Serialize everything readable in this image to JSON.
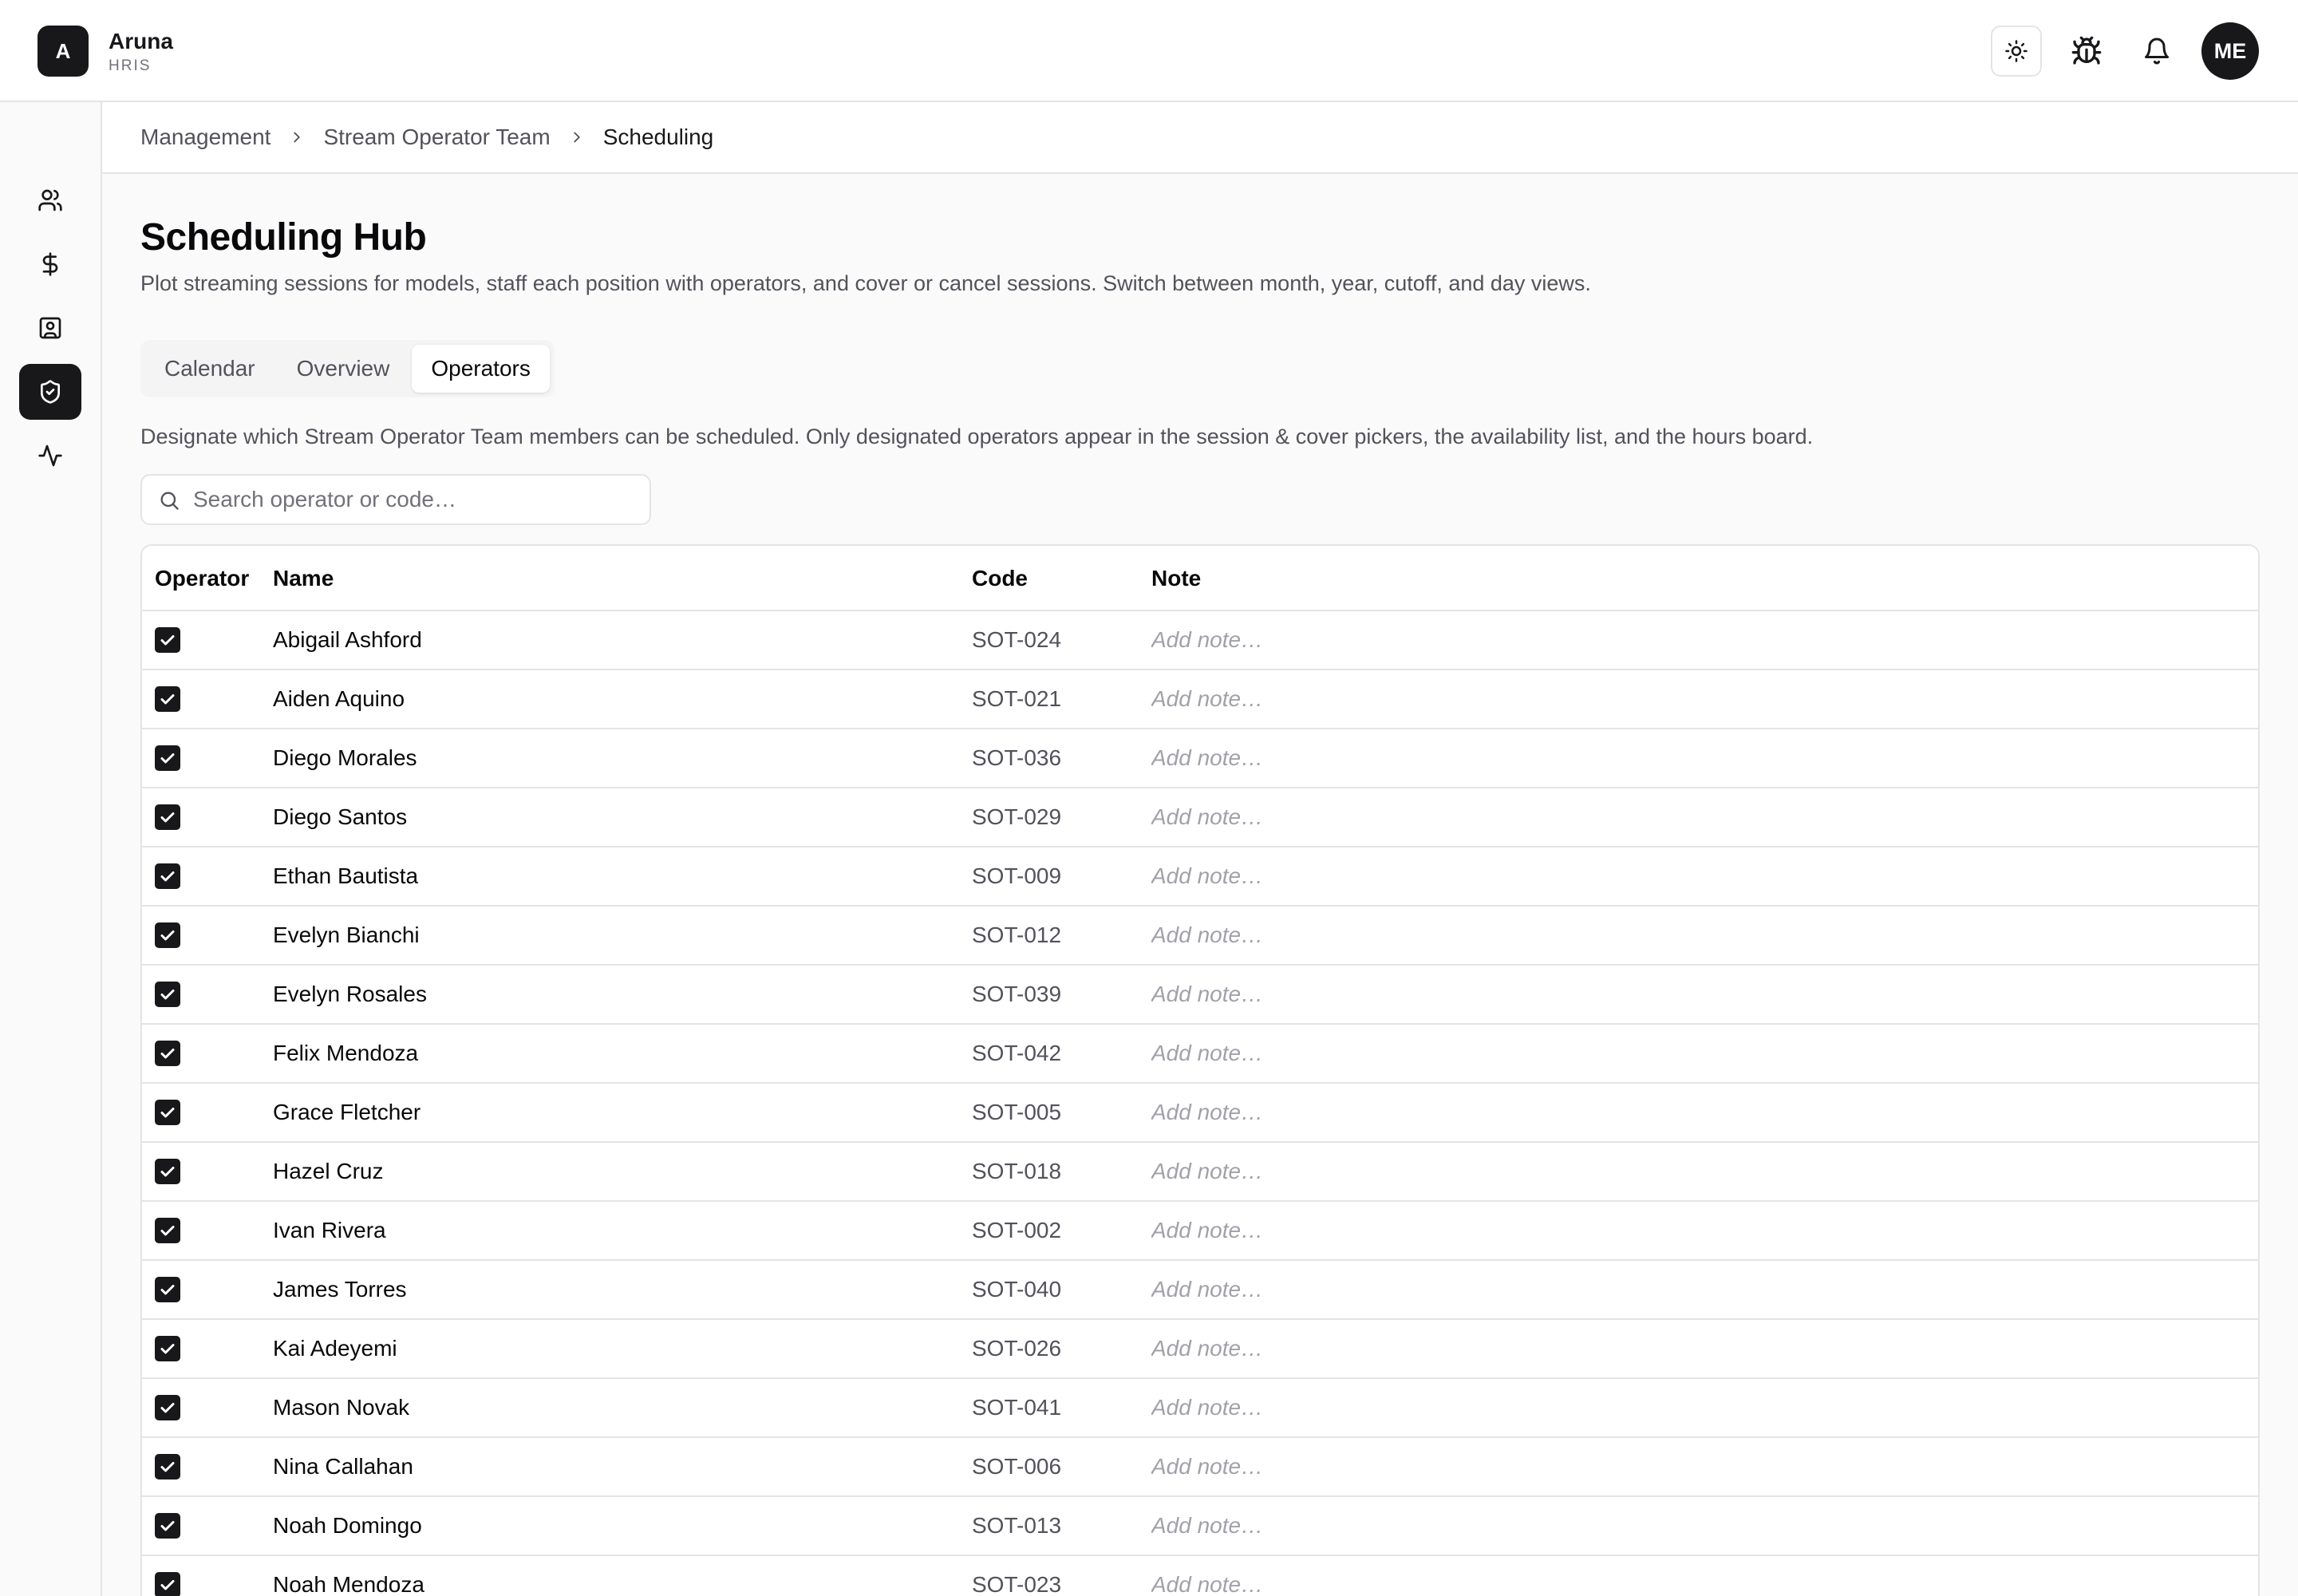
{
  "brand": {
    "initial": "A",
    "name": "Aruna",
    "subtitle": "HRIS"
  },
  "header": {
    "theme_icon": "sun-icon",
    "bug_icon": "bug-icon",
    "bell_icon": "bell-icon",
    "avatar_initials": "ME"
  },
  "sidebar": {
    "items": [
      {
        "icon": "users-icon",
        "active": false
      },
      {
        "icon": "dollar-icon",
        "active": false
      },
      {
        "icon": "id-card-icon",
        "active": false
      },
      {
        "icon": "shield-check-icon",
        "active": true
      },
      {
        "icon": "activity-icon",
        "active": false
      }
    ]
  },
  "breadcrumb": [
    "Management",
    "Stream Operator Team",
    "Scheduling"
  ],
  "page": {
    "title": "Scheduling Hub",
    "description": "Plot streaming sessions for models, staff each position with operators, and cover or cancel sessions. Switch between month, year, cutoff, and day views."
  },
  "tabs": [
    {
      "label": "Calendar",
      "active": false
    },
    {
      "label": "Overview",
      "active": false
    },
    {
      "label": "Operators",
      "active": true
    }
  ],
  "operators_info": "Designate which Stream Operator Team members can be scheduled. Only designated operators appear in the session & cover pickers, the availability list, and the hours board.",
  "search": {
    "placeholder": "Search operator or code…",
    "value": ""
  },
  "table": {
    "columns": {
      "operator": "Operator",
      "name": "Name",
      "code": "Code",
      "note": "Note"
    },
    "note_placeholder": "Add note…",
    "rows": [
      {
        "name": "Abigail Ashford",
        "code": "SOT-024",
        "operator": true,
        "note": ""
      },
      {
        "name": "Aiden Aquino",
        "code": "SOT-021",
        "operator": true,
        "note": ""
      },
      {
        "name": "Diego Morales",
        "code": "SOT-036",
        "operator": true,
        "note": ""
      },
      {
        "name": "Diego Santos",
        "code": "SOT-029",
        "operator": true,
        "note": ""
      },
      {
        "name": "Ethan Bautista",
        "code": "SOT-009",
        "operator": true,
        "note": ""
      },
      {
        "name": "Evelyn Bianchi",
        "code": "SOT-012",
        "operator": true,
        "note": ""
      },
      {
        "name": "Evelyn Rosales",
        "code": "SOT-039",
        "operator": true,
        "note": ""
      },
      {
        "name": "Felix Mendoza",
        "code": "SOT-042",
        "operator": true,
        "note": ""
      },
      {
        "name": "Grace Fletcher",
        "code": "SOT-005",
        "operator": true,
        "note": ""
      },
      {
        "name": "Hazel Cruz",
        "code": "SOT-018",
        "operator": true,
        "note": ""
      },
      {
        "name": "Ivan Rivera",
        "code": "SOT-002",
        "operator": true,
        "note": ""
      },
      {
        "name": "James Torres",
        "code": "SOT-040",
        "operator": true,
        "note": ""
      },
      {
        "name": "Kai Adeyemi",
        "code": "SOT-026",
        "operator": true,
        "note": ""
      },
      {
        "name": "Mason Novak",
        "code": "SOT-041",
        "operator": true,
        "note": ""
      },
      {
        "name": "Nina Callahan",
        "code": "SOT-006",
        "operator": true,
        "note": ""
      },
      {
        "name": "Noah Domingo",
        "code": "SOT-013",
        "operator": true,
        "note": ""
      },
      {
        "name": "Noah Mendoza",
        "code": "SOT-023",
        "operator": true,
        "note": ""
      }
    ]
  },
  "colors": {
    "primary": "#18181b",
    "muted_text": "#52525b",
    "border": "#e4e4e7",
    "background": "#fafafa",
    "placeholder": "#a1a1aa"
  }
}
